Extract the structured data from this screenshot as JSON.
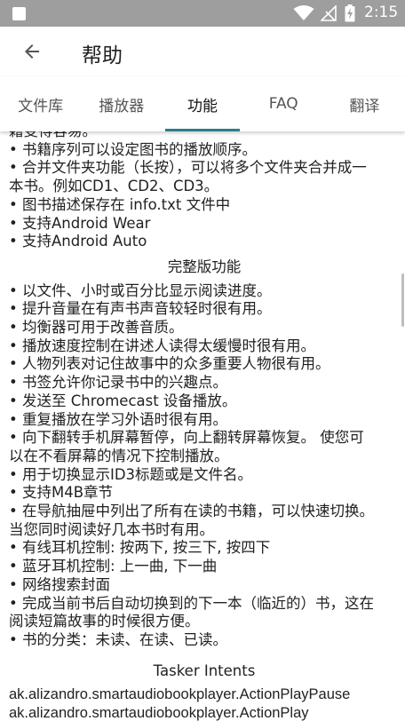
{
  "status_bar": {
    "time": "2:15",
    "icons": [
      "notification-square-icon",
      "wifi-icon",
      "no-signal-icon",
      "battery-charging-icon"
    ]
  },
  "app_bar": {
    "title": "帮助",
    "back_icon": "arrow-back-icon"
  },
  "tabs": [
    {
      "label": "文件库"
    },
    {
      "label": "播放器"
    },
    {
      "label": "功能",
      "active": true
    },
    {
      "label": "FAQ"
    },
    {
      "label": "翻译"
    }
  ],
  "content": {
    "top_lines": [
      "籍变得容易。",
      "• 书籍序列可以设定图书的播放顺序。",
      "• 合并文件夹功能（长按），可以将多个文件夹合并成一",
      "本书。例如CD1、CD2、CD3。",
      "• 图书描述保存在 info.txt 文件中",
      "• 支持Android Wear",
      "• 支持Android Auto"
    ],
    "full_heading": "完整版功能",
    "full_lines": [
      "• 以文件、小时或百分比显示阅读进度。",
      "• 提升音量在有声书声音较轻时很有用。",
      "• 均衡器可用于改善音质。",
      "• 播放速度控制在讲述人读得太缓慢时很有用。",
      "• 人物列表对记住故事中的众多重要人物很有用。",
      "• 书签允许你记录书中的兴趣点。",
      "• 发送至 Chromecast 设备播放。",
      "• 重复播放在学习外语时很有用。",
      "• 向下翻转手机屏幕暂停，向上翻转屏幕恢复。 使您可",
      "以在不看屏幕的情况下控制播放。",
      "• 用于切换显示ID3标题或是文件名。",
      "• 支持M4B章节",
      "• 在导航抽屉中列出了所有在读的书籍，可以快速切换。",
      "当您同时阅读好几本书时有用。",
      "• 有线耳机控制: 按两下, 按三下, 按四下",
      "• 蓝牙耳机控制: 上一曲, 下一曲",
      "• 网络搜索封面",
      "• 完成当前书后自动切换到的下一本（临近的）书，这在",
      "阅读短篇故事的时候很方便。",
      "• 书的分类：未读、在读、已读。"
    ],
    "tasker_heading": "Tasker Intents",
    "intents": [
      "ak.alizandro.smartaudiobookplayer.ActionPlayPause",
      "ak.alizandro.smartaudiobookplayer.ActionPlay"
    ]
  },
  "colors": {
    "status_bar": "#9e9e9e",
    "tab_indicator": "#2e7d8a",
    "text": "#212121"
  }
}
